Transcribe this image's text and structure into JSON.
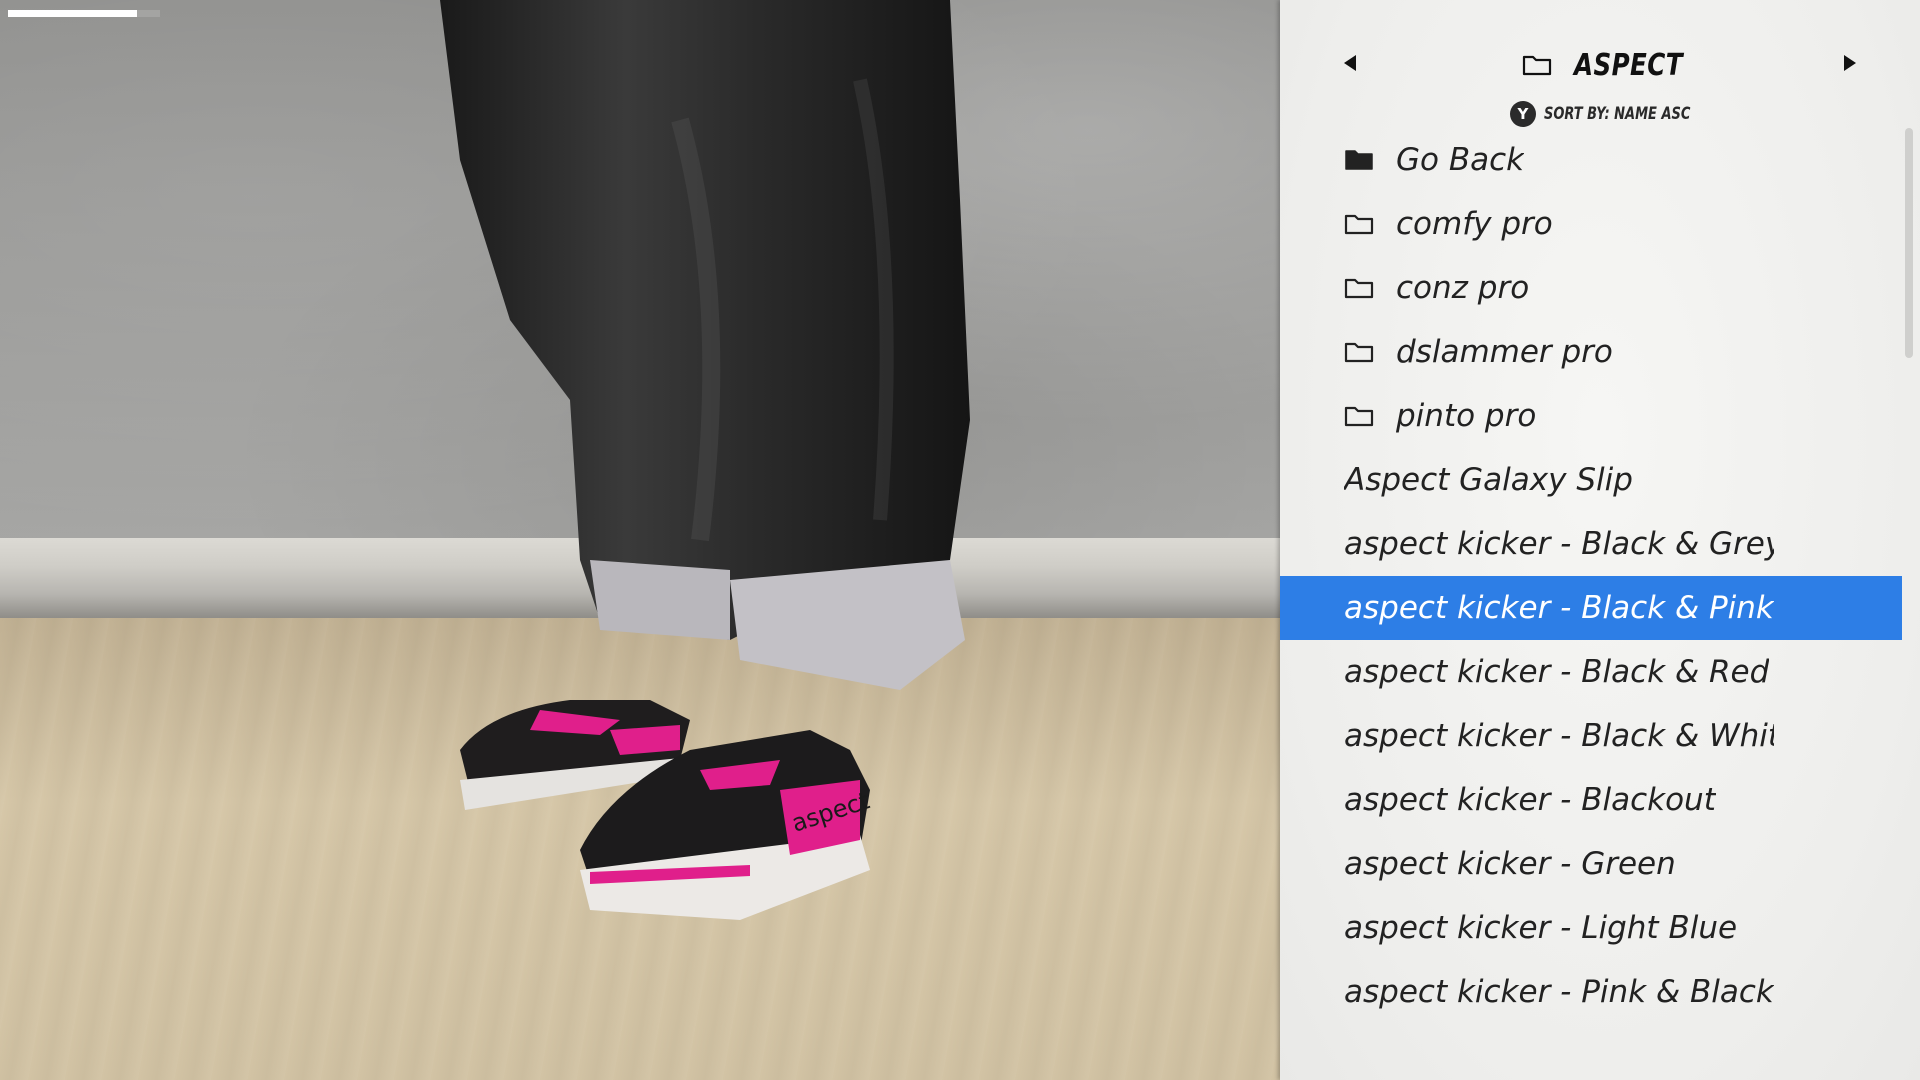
{
  "hud": {
    "progress": 0.85
  },
  "menu": {
    "title": "ASPECT",
    "sort": {
      "button": "Y",
      "label": "SORT BY: NAME ASC"
    },
    "icons": {
      "header": "folder-outline-icon",
      "go_back": "folder-filled-icon",
      "folder": "folder-outline-icon"
    },
    "accent_color": "#2d7ee6",
    "items": [
      {
        "label": "Go Back",
        "type": "back"
      },
      {
        "label": "comfy pro",
        "type": "folder"
      },
      {
        "label": "conz pro",
        "type": "folder"
      },
      {
        "label": "dslammer pro",
        "type": "folder"
      },
      {
        "label": "pinto pro",
        "type": "folder"
      },
      {
        "label": "Aspect Galaxy Slip",
        "type": "item"
      },
      {
        "label": "aspect kicker - Black & Grey & I",
        "type": "item"
      },
      {
        "label": "aspect kicker - Black & Pink",
        "type": "item",
        "selected": true
      },
      {
        "label": "aspect kicker - Black & Red",
        "type": "item"
      },
      {
        "label": "aspect kicker - Black & White",
        "type": "item"
      },
      {
        "label": "aspect kicker - Blackout",
        "type": "item"
      },
      {
        "label": "aspect kicker - Green",
        "type": "item"
      },
      {
        "label": "aspect kicker - Light Blue",
        "type": "item"
      },
      {
        "label": "aspect kicker - Pink & Black",
        "type": "item"
      }
    ]
  },
  "preview": {
    "shoe_brand_text": "aspect"
  }
}
